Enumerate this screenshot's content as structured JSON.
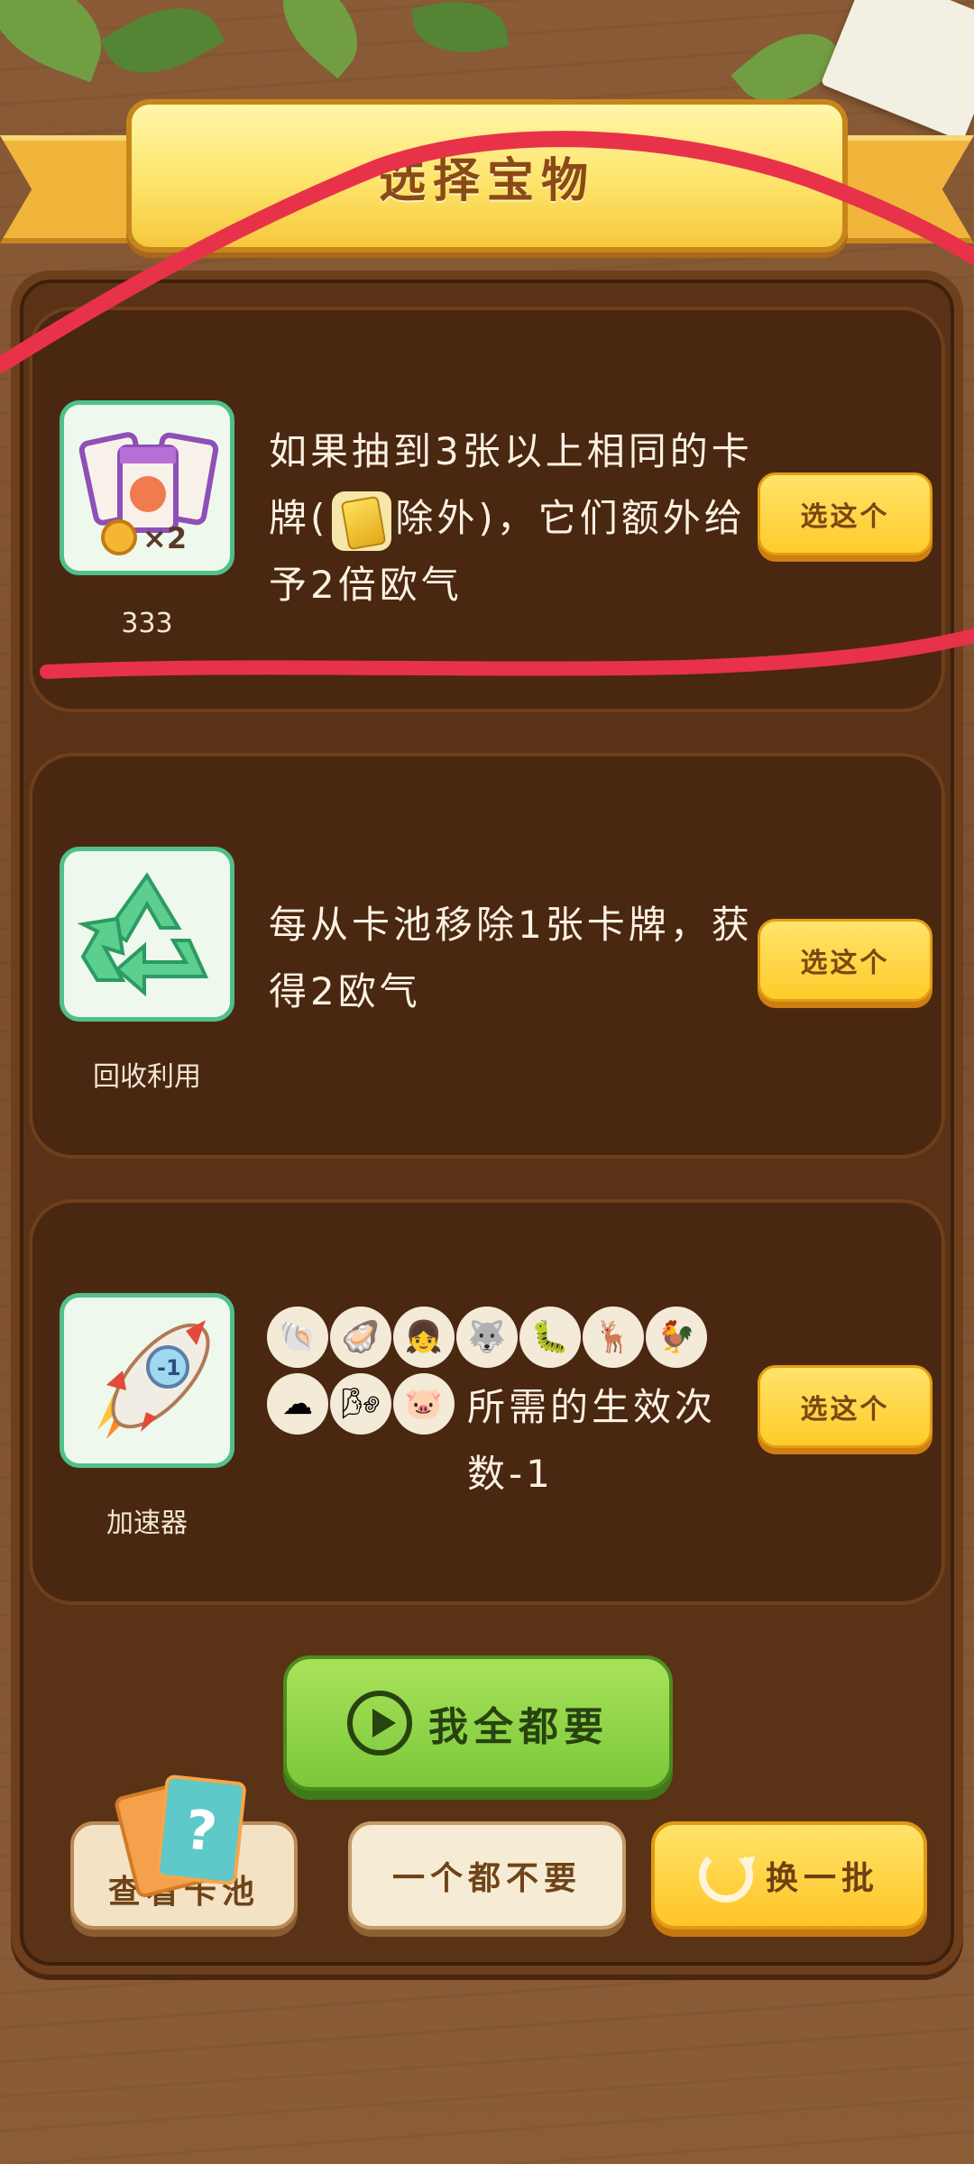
{
  "header": {
    "title": "选择宝物"
  },
  "options": [
    {
      "name": "333",
      "icon": "double-card-coin-icon",
      "desc_part1": "如果抽到3张以上相同的卡牌(",
      "desc_part2": "除外)，它们额外给予2倍欧气",
      "button": "选这个"
    },
    {
      "name": "回收利用",
      "icon": "recycle-icon",
      "desc": "每从卡池移除1张卡牌，获得2欧气",
      "button": "选这个"
    },
    {
      "name": "加速器",
      "icon": "rocket-icon",
      "desc_suffix": "所需的生效次数-1",
      "button": "选这个",
      "required_items": [
        "shell-icon",
        "oyster-icon",
        "girl-icon",
        "husky-icon",
        "caterpillar-icon",
        "deer-icon",
        "rooster-icon",
        "cloud-icon",
        "wind-icon",
        "piggy-bank-icon"
      ]
    }
  ],
  "actions": {
    "take_all": "我全都要",
    "view_pool": "查看卡池",
    "take_none": "一个都不要",
    "refresh": "换一批"
  },
  "colors": {
    "board": "#5a3216",
    "card": "#4a2710",
    "choose_button": "#ffcb2b",
    "take_all_button": "#7cc83a",
    "annotation": "#e8324a"
  }
}
